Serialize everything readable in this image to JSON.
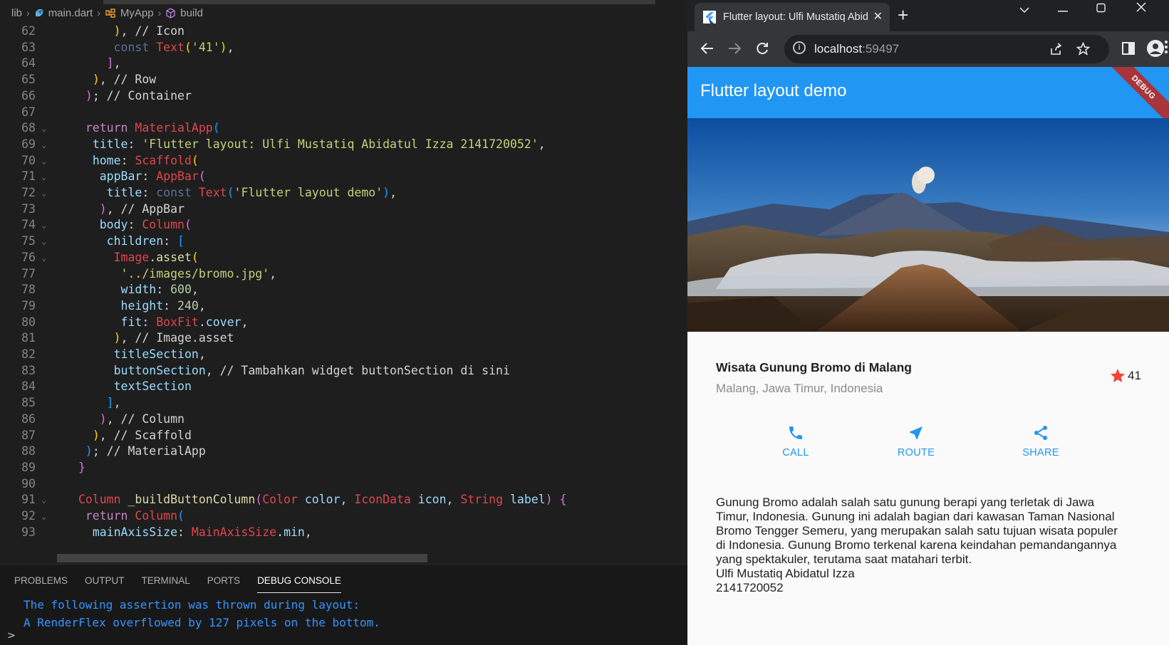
{
  "vscode": {
    "breadcrumb": {
      "folder": "lib",
      "file": "main.dart",
      "class": "MyApp",
      "method": "build"
    },
    "code_lines": [
      {
        "num": "62",
        "tokens": [
          [
            "",
            "      "
          ],
          [
            "c-y",
            ")"
          ],
          [
            "c-cm",
            ", // Icon"
          ]
        ]
      },
      {
        "num": "63",
        "tokens": [
          [
            "",
            "      "
          ],
          [
            "c-const",
            "const "
          ],
          [
            "c-cls",
            "Text"
          ],
          [
            "c-y",
            "("
          ],
          [
            "c-strg",
            "'41'"
          ],
          [
            "c-y",
            ")"
          ],
          [
            "c-cm",
            ","
          ]
        ]
      },
      {
        "num": "64",
        "tokens": [
          [
            "",
            "     "
          ],
          [
            "c-p",
            "]"
          ],
          [
            "c-cm",
            ","
          ]
        ]
      },
      {
        "num": "65",
        "tokens": [
          [
            "",
            "   "
          ],
          [
            "c-y",
            ")"
          ],
          [
            "c-cm",
            ", // Row"
          ]
        ]
      },
      {
        "num": "66",
        "tokens": [
          [
            "",
            "  "
          ],
          [
            "c-p",
            ")"
          ],
          [
            "c-cm",
            "; // Container"
          ]
        ]
      },
      {
        "num": "67",
        "tokens": [
          [
            "",
            ""
          ]
        ]
      },
      {
        "num": "68",
        "tokens": [
          [
            "",
            "  "
          ],
          [
            "c-kw",
            "return "
          ],
          [
            "c-cls",
            "MaterialApp"
          ],
          [
            "c-b",
            "("
          ]
        ]
      },
      {
        "num": "69",
        "tokens": [
          [
            "",
            "   "
          ],
          [
            "c-key",
            "title"
          ],
          [
            "c-cm",
            ": "
          ],
          [
            "c-strg",
            "'Flutter layout: Ulfi Mustatiq Abidatul Izza 2141720052'"
          ],
          [
            "c-cm",
            ","
          ]
        ]
      },
      {
        "num": "70",
        "tokens": [
          [
            "",
            "   "
          ],
          [
            "c-key",
            "home"
          ],
          [
            "c-cm",
            ": "
          ],
          [
            "c-cls",
            "Scaffold"
          ],
          [
            "c-y",
            "("
          ]
        ]
      },
      {
        "num": "71",
        "tokens": [
          [
            "",
            "    "
          ],
          [
            "c-key",
            "appBar"
          ],
          [
            "c-cm",
            ": "
          ],
          [
            "c-cls",
            "AppBar"
          ],
          [
            "c-p",
            "("
          ]
        ]
      },
      {
        "num": "72",
        "tokens": [
          [
            "",
            "     "
          ],
          [
            "c-key",
            "title"
          ],
          [
            "c-cm",
            ": "
          ],
          [
            "c-const",
            "const "
          ],
          [
            "c-cls",
            "Text"
          ],
          [
            "c-b",
            "("
          ],
          [
            "c-strg",
            "'Flutter layout demo'"
          ],
          [
            "c-b",
            ")"
          ],
          [
            "c-cm",
            ","
          ]
        ]
      },
      {
        "num": "73",
        "tokens": [
          [
            "",
            "    "
          ],
          [
            "c-p",
            ")"
          ],
          [
            "c-cm",
            ", // AppBar"
          ]
        ]
      },
      {
        "num": "74",
        "tokens": [
          [
            "",
            "    "
          ],
          [
            "c-key",
            "body"
          ],
          [
            "c-cm",
            ": "
          ],
          [
            "c-cls",
            "Column"
          ],
          [
            "c-p",
            "("
          ]
        ]
      },
      {
        "num": "75",
        "tokens": [
          [
            "",
            "     "
          ],
          [
            "c-key",
            "children"
          ],
          [
            "c-cm",
            ": "
          ],
          [
            "c-b",
            "["
          ]
        ]
      },
      {
        "num": "76",
        "tokens": [
          [
            "",
            "      "
          ],
          [
            "c-cls",
            "Image"
          ],
          [
            "c-cm",
            "."
          ],
          [
            "c-fn",
            "asset"
          ],
          [
            "c-y",
            "("
          ]
        ]
      },
      {
        "num": "77",
        "tokens": [
          [
            "",
            "       "
          ],
          [
            "c-strg",
            "'../images/bromo.jpg'"
          ],
          [
            "c-cm",
            ","
          ]
        ]
      },
      {
        "num": "78",
        "tokens": [
          [
            "",
            "       "
          ],
          [
            "c-key",
            "width"
          ],
          [
            "c-cm",
            ": "
          ],
          [
            "c-num",
            "600"
          ],
          [
            "c-cm",
            ","
          ]
        ]
      },
      {
        "num": "79",
        "tokens": [
          [
            "",
            "       "
          ],
          [
            "c-key",
            "height"
          ],
          [
            "c-cm",
            ": "
          ],
          [
            "c-num",
            "240"
          ],
          [
            "c-cm",
            ","
          ]
        ]
      },
      {
        "num": "80",
        "tokens": [
          [
            "",
            "       "
          ],
          [
            "c-key",
            "fit"
          ],
          [
            "c-cm",
            ": "
          ],
          [
            "c-cls",
            "BoxFit"
          ],
          [
            "c-cm",
            "."
          ],
          [
            "c-key",
            "cover"
          ],
          [
            "c-cm",
            ","
          ]
        ]
      },
      {
        "num": "81",
        "tokens": [
          [
            "",
            "      "
          ],
          [
            "c-y",
            ")"
          ],
          [
            "c-cm",
            ", // Image.asset"
          ]
        ]
      },
      {
        "num": "82",
        "tokens": [
          [
            "",
            "      "
          ],
          [
            "c-key",
            "titleSection"
          ],
          [
            "c-cm",
            ","
          ]
        ]
      },
      {
        "num": "83",
        "tokens": [
          [
            "",
            "      "
          ],
          [
            "c-key",
            "buttonSection"
          ],
          [
            "c-cm",
            ", // Tambahkan widget buttonSection di sini"
          ]
        ]
      },
      {
        "num": "84",
        "tokens": [
          [
            "",
            "      "
          ],
          [
            "c-key",
            "textSection"
          ]
        ]
      },
      {
        "num": "85",
        "tokens": [
          [
            "",
            "     "
          ],
          [
            "c-b",
            "]"
          ],
          [
            "c-cm",
            ","
          ]
        ]
      },
      {
        "num": "86",
        "tokens": [
          [
            "",
            "    "
          ],
          [
            "c-p",
            ")"
          ],
          [
            "c-cm",
            ", // Column"
          ]
        ]
      },
      {
        "num": "87",
        "tokens": [
          [
            "",
            "   "
          ],
          [
            "c-y",
            ")"
          ],
          [
            "c-cm",
            ", // Scaffold"
          ]
        ]
      },
      {
        "num": "88",
        "tokens": [
          [
            "",
            "  "
          ],
          [
            "c-b",
            ")"
          ],
          [
            "c-cm",
            "; // MaterialApp"
          ]
        ]
      },
      {
        "num": "89",
        "tokens": [
          [
            "",
            " "
          ],
          [
            "c-p",
            "}"
          ]
        ]
      },
      {
        "num": "90",
        "tokens": [
          [
            "",
            ""
          ]
        ]
      },
      {
        "num": "91",
        "tokens": [
          [
            "",
            " "
          ],
          [
            "c-cls",
            "Column "
          ],
          [
            "c-fn",
            "_buildButtonColumn"
          ],
          [
            "c-p",
            "("
          ],
          [
            "c-cls",
            "Color "
          ],
          [
            "c-prm",
            "color"
          ],
          [
            "c-cm",
            ", "
          ],
          [
            "c-cls",
            "IconData "
          ],
          [
            "c-prm",
            "icon"
          ],
          [
            "c-cm",
            ", "
          ],
          [
            "c-cls",
            "String "
          ],
          [
            "c-prm",
            "label"
          ],
          [
            "c-p",
            ")"
          ],
          [
            "c-cm",
            " "
          ],
          [
            "c-p",
            "{"
          ]
        ]
      },
      {
        "num": "92",
        "tokens": [
          [
            "",
            "  "
          ],
          [
            "c-kw",
            "return "
          ],
          [
            "c-cls",
            "Column"
          ],
          [
            "c-b",
            "("
          ]
        ]
      },
      {
        "num": "93",
        "tokens": [
          [
            "",
            "   "
          ],
          [
            "c-key",
            "mainAxisSize"
          ],
          [
            "c-cm",
            ": "
          ],
          [
            "c-cls",
            "MainAxisSize"
          ],
          [
            "c-cm",
            "."
          ],
          [
            "c-key",
            "min"
          ],
          [
            "c-cm",
            ","
          ]
        ]
      }
    ],
    "panel": {
      "tabs": [
        "PROBLEMS",
        "OUTPUT",
        "TERMINAL",
        "PORTS",
        "DEBUG CONSOLE"
      ],
      "active_tab": "DEBUG CONSOLE",
      "console_lines": [
        "The following assertion was thrown during layout:",
        "A RenderFlex overflowed by 127 pixels on the bottom."
      ],
      "prompt": ">"
    }
  },
  "browser": {
    "tab_title": "Flutter layout: Ulfi Mustatiq Abid",
    "tab_close": "✕",
    "new_tab": "+",
    "url_host": "localhost",
    "url_port": ":59497",
    "app": {
      "appbar_title": "Flutter layout demo",
      "debug_banner": "DEBUG",
      "place_name": "Wisata Gunung Bromo di Malang",
      "place_location": "Malang, Jawa Timur, Indonesia",
      "star_count": "41",
      "buttons": [
        {
          "label": "CALL",
          "icon": "phone-icon"
        },
        {
          "label": "ROUTE",
          "icon": "near-me-icon"
        },
        {
          "label": "SHARE",
          "icon": "share-icon"
        }
      ],
      "description_lines": [
        "Gunung Bromo adalah salah satu gunung berapi yang terletak di Jawa",
        "Timur, Indonesia. Gunung ini adalah bagian dari kawasan Taman Nasional",
        "Bromo Tengger Semeru, yang merupakan salah satu tujuan wisata populer",
        "di Indonesia. Gunung Bromo terkenal karena keindahan pemandangannya",
        "yang spektakuler, terutama saat matahari terbit.",
        "Ulfi Mustatiq Abidatul Izza",
        "2141720052"
      ]
    }
  },
  "colors": {
    "appbar": "#2196f3",
    "star": "#f44336",
    "button": "#2196f3",
    "console": "#3794ff"
  }
}
